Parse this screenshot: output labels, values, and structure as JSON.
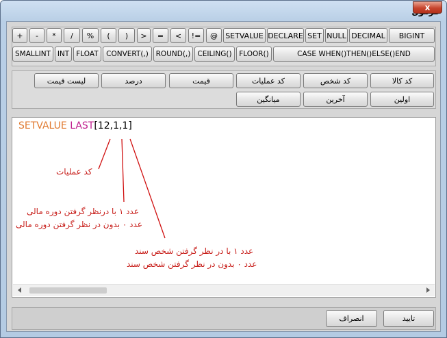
{
  "window": {
    "title": "فرمول",
    "close_label": "x"
  },
  "operators": [
    "+",
    "-",
    "*",
    "/",
    "%",
    "(",
    ")",
    ">",
    "=",
    "<",
    "!=",
    "@",
    "SETVALUE",
    "DECLARE",
    "SET",
    "NULL",
    "DECIMAL",
    "BIGINT"
  ],
  "functions": [
    "SMALLINT",
    "INT",
    "FLOAT",
    "CONVERT(,)",
    "ROUND(,)",
    "CEILING()",
    "FLOOR()",
    "CASE WHEN()THEN()ELSE()END"
  ],
  "fields_row1": [
    "کد کالا",
    "کد شخص",
    "کد عملیات",
    "قیمت",
    "درصد",
    "لیست قیمت"
  ],
  "fields_row2": [
    "اولین",
    "آخرین",
    "میانگین"
  ],
  "editor": {
    "keyword_set": "SETVALUE",
    "keyword_last": "LAST",
    "args": "[12,1,1]"
  },
  "annotations": {
    "op_code": "کد عملیات",
    "fiscal_line1": "عدد ۱ با درنظر گرفتن دوره مالی",
    "fiscal_line2": "عدد ۰ بدون در نظر گرفتن دوره مالی",
    "person_line1": "عدد ۱ با در نظر گرفتن شخص سند",
    "person_line2": "عدد ۰ بدون در نظر گرفتن شخص سند"
  },
  "footer": {
    "confirm": "تایید",
    "cancel": "انصراف"
  },
  "colors": {
    "keyword_set": "#e07a30",
    "keyword_last": "#c0208f",
    "annotation": "#c8201c",
    "title_bar": "#c4d8ee"
  }
}
